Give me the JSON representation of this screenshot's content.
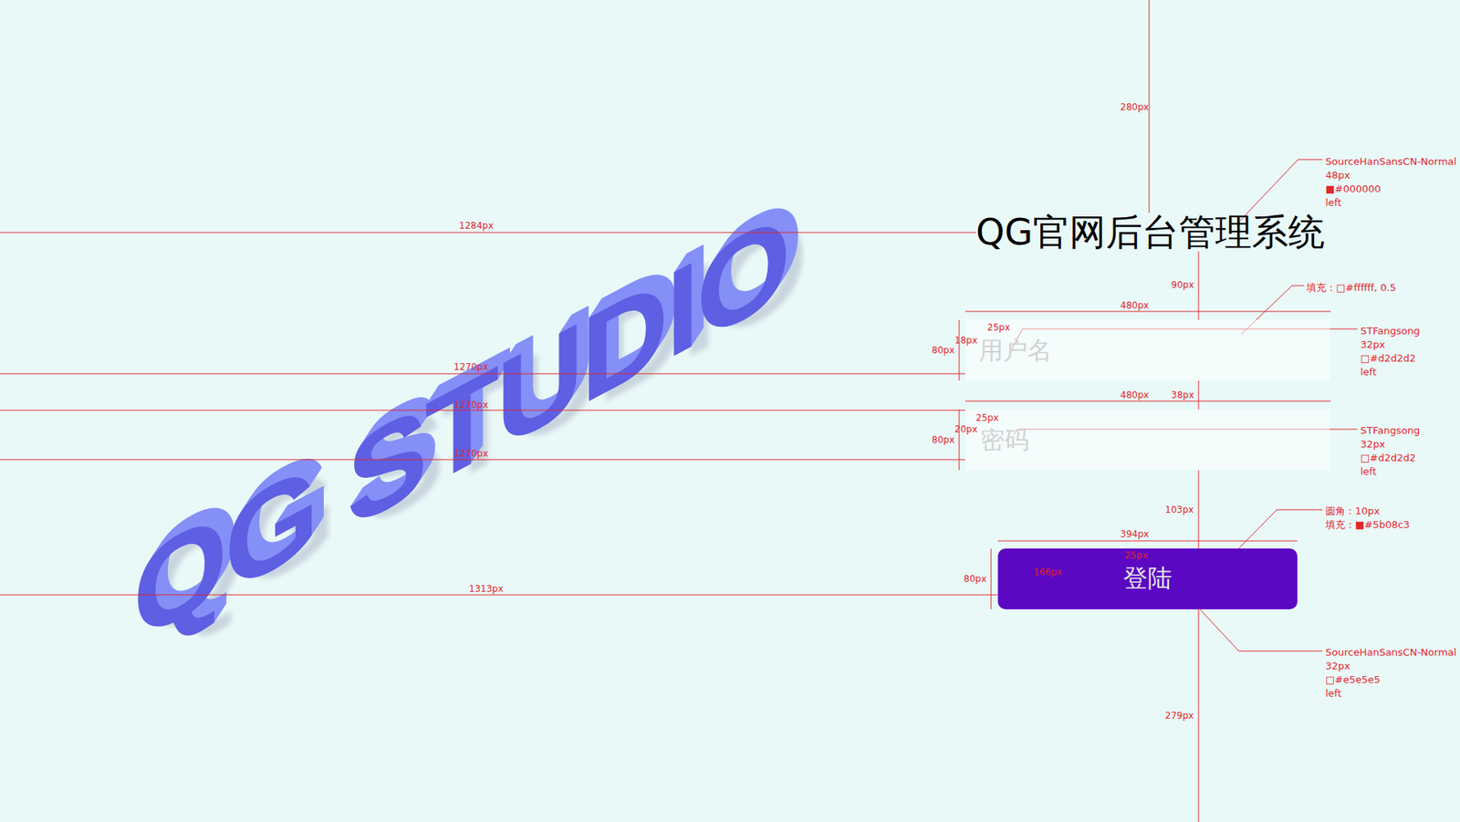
{
  "title": "QG官网后台管理系统",
  "logo": "QG STUDIO",
  "fields": [
    {
      "placeholder": "用户名",
      "kind": "text"
    },
    {
      "placeholder": "密码",
      "kind": "password"
    }
  ],
  "login_button": "登陆",
  "annotations": {
    "dimensions": [
      "280px",
      "1284px",
      "90px",
      "480px",
      "25px",
      "18px",
      "80px",
      "1270px",
      "480px",
      "38px",
      "1270px",
      "25px",
      "20px",
      "80px",
      "1270px",
      "103px",
      "394px",
      "25px",
      "166px",
      "80px",
      "1313px",
      "279px"
    ],
    "notes": [
      [
        "SourceHanSansCN-Normal",
        "48px",
        "■#000000",
        "left"
      ],
      [
        "填充：□#ffffff, 0.5"
      ],
      [
        "STFangsong",
        "32px",
        "□#d2d2d2",
        "left"
      ],
      [
        "STFangsong",
        "32px",
        "□#d2d2d2",
        "left"
      ],
      [
        "圆角：10px",
        "填充：■#5b08c3"
      ],
      [
        "SourceHanSansCN-Normal",
        "32px",
        "□#e5e5e5",
        "left"
      ]
    ]
  }
}
